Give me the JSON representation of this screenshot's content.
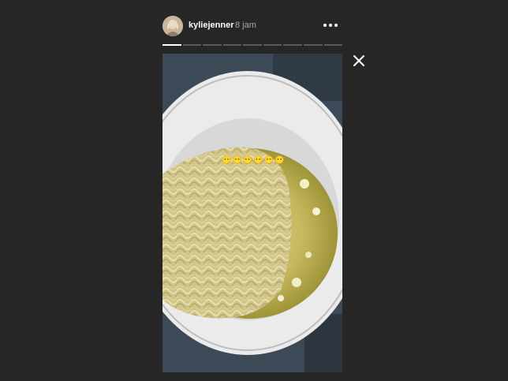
{
  "story": {
    "username": "kyliejenner",
    "time": "8 jam",
    "progress": {
      "segments": 9,
      "active_index": 0,
      "active_fraction": 1.0
    },
    "sticker_text": "😶😶😶😶😶😶"
  },
  "icons": {
    "more": "more-options-icon",
    "close": "close-icon"
  },
  "colors": {
    "background": "#262626",
    "text_primary": "#ffffff",
    "text_secondary": "#a8a8a8"
  }
}
